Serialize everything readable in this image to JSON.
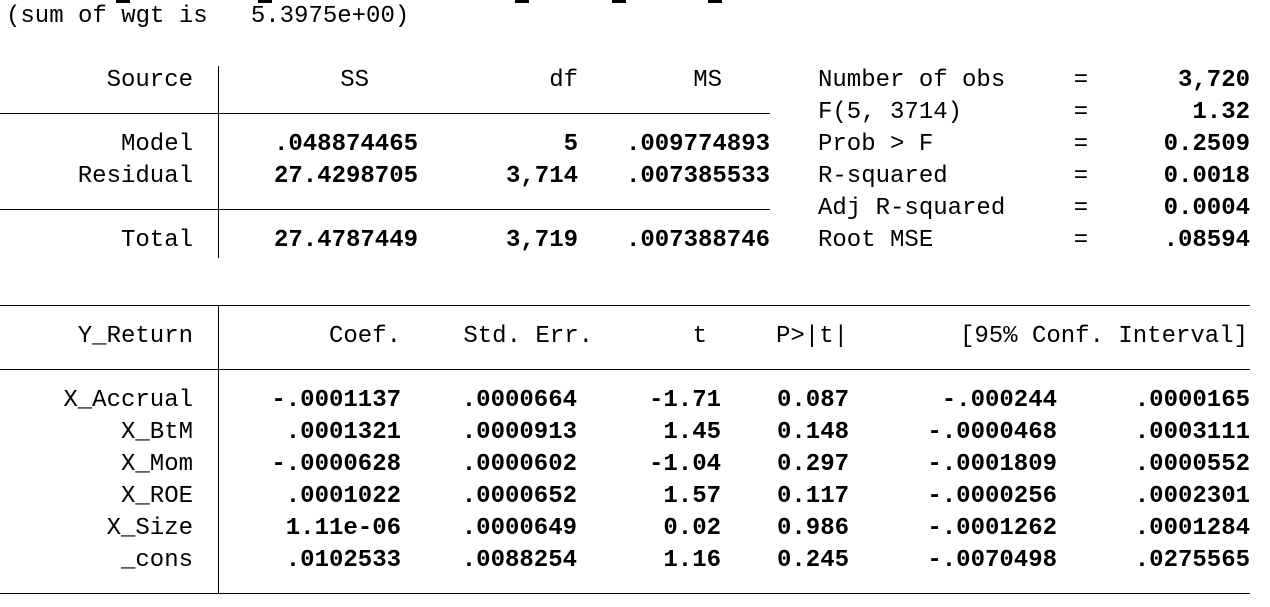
{
  "sum_line": "(sum of wgt is   5.3975e+00)",
  "anova": {
    "headers": [
      "Source",
      "SS",
      "df",
      "MS"
    ],
    "rows": [
      {
        "source": "Model",
        "ss": ".048874465",
        "df": "5",
        "ms": ".009774893"
      },
      {
        "source": "Residual",
        "ss": "27.4298705",
        "df": "3,714",
        "ms": ".007385533"
      }
    ],
    "total": {
      "source": "Total",
      "ss": "27.4787449",
      "df": "3,719",
      "ms": ".007388746"
    }
  },
  "stats": [
    {
      "label": "Number of obs",
      "eq": "=",
      "value": "3,720"
    },
    {
      "label": "F(5, 3714)",
      "eq": "=",
      "value": "1.32"
    },
    {
      "label": "Prob > F",
      "eq": "=",
      "value": "0.2509"
    },
    {
      "label": "R-squared",
      "eq": "=",
      "value": "0.0018"
    },
    {
      "label": "Adj R-squared",
      "eq": "=",
      "value": "0.0004"
    },
    {
      "label": "Root MSE",
      "eq": "=",
      "value": ".08594"
    }
  ],
  "coef_table": {
    "depvar": "Y_Return",
    "headers": [
      "Coef.",
      "Std. Err.",
      "t",
      "P>|t|",
      "[95% Conf. Interval]"
    ],
    "rows": [
      {
        "var": "X_Accrual",
        "coef": "-.0001137",
        "se": ".0000664",
        "t": "-1.71",
        "p": "0.087",
        "lo": "-.000244",
        "hi": ".0000165"
      },
      {
        "var": "X_BtM",
        "coef": ".0001321",
        "se": ".0000913",
        "t": "1.45",
        "p": "0.148",
        "lo": "-.0000468",
        "hi": ".0003111"
      },
      {
        "var": "X_Mom",
        "coef": "-.0000628",
        "se": ".0000602",
        "t": "-1.04",
        "p": "0.297",
        "lo": "-.0001809",
        "hi": ".0000552"
      },
      {
        "var": "X_ROE",
        "coef": ".0001022",
        "se": ".0000652",
        "t": "1.57",
        "p": "0.117",
        "lo": "-.0000256",
        "hi": ".0002301"
      },
      {
        "var": "X_Size",
        "coef": "1.11e-06",
        "se": ".0000649",
        "t": "0.02",
        "p": "0.986",
        "lo": "-.0001262",
        "hi": ".0001284"
      },
      {
        "var": "_cons",
        "coef": ".0102533",
        "se": ".0088254",
        "t": "1.16",
        "p": "0.245",
        "lo": "-.0070498",
        "hi": ".0275565"
      }
    ]
  }
}
